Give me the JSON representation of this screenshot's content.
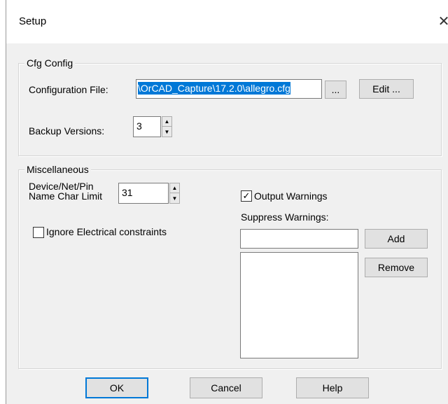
{
  "window": {
    "title": "Setup",
    "close_glyph": "✕"
  },
  "cfg_config": {
    "legend": "Cfg Config",
    "config_file_label": "Configuration File:",
    "config_file_value": "\\OrCAD_Capture\\17.2.0\\allegro.cfg",
    "browse_label": "...",
    "edit_label": "Edit ...",
    "backup_label": "Backup Versions:",
    "backup_value": "3"
  },
  "misc": {
    "legend": "Miscellaneous",
    "char_limit_label_line1": "Device/Net/Pin",
    "char_limit_label_line2": "Name Char Limit",
    "char_limit_value": "31",
    "ignore_constraints_label": "Ignore Electrical constraints",
    "ignore_constraints_checked": false,
    "output_warnings_label": "Output Warnings",
    "output_warnings_checked": true,
    "suppress_warnings_label": "Suppress Warnings:",
    "suppress_input_value": "",
    "add_label": "Add",
    "remove_label": "Remove"
  },
  "footer": {
    "ok_label": "OK",
    "cancel_label": "Cancel",
    "help_label": "Help"
  },
  "icons": {
    "spin_up": "▲",
    "spin_down": "▼",
    "check": "✓"
  }
}
